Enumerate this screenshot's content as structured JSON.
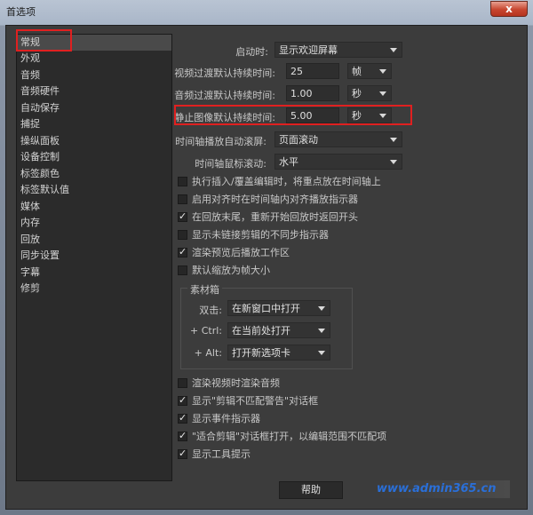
{
  "window": {
    "title": "首选项",
    "close_label": "x"
  },
  "sidebar": {
    "items": [
      {
        "label": "常规",
        "selected": true
      },
      {
        "label": "外观"
      },
      {
        "label": "音频"
      },
      {
        "label": "音频硬件"
      },
      {
        "label": "自动保存"
      },
      {
        "label": "捕捉"
      },
      {
        "label": "操纵面板"
      },
      {
        "label": "设备控制"
      },
      {
        "label": "标签颜色"
      },
      {
        "label": "标签默认值"
      },
      {
        "label": "媒体"
      },
      {
        "label": "内存"
      },
      {
        "label": "回放"
      },
      {
        "label": "同步设置"
      },
      {
        "label": "字幕"
      },
      {
        "label": "修剪"
      }
    ]
  },
  "general": {
    "startup_label": "启动时:",
    "startup_value": "显示欢迎屏幕",
    "video_transition_label": "视频过渡默认持续时间:",
    "video_transition_value": "25",
    "video_transition_unit": "帧",
    "audio_transition_label": "音频过渡默认持续时间:",
    "audio_transition_value": "1.00",
    "audio_transition_unit": "秒",
    "still_image_label": "静止图像默认持续时间:",
    "still_image_value": "5.00",
    "still_image_unit": "秒",
    "timeline_scroll_label": "时间轴播放自动滚屏:",
    "timeline_scroll_value": "页面滚动",
    "mouse_scroll_label": "时间轴鼠标滚动:",
    "mouse_scroll_value": "水平"
  },
  "checkboxes": [
    {
      "label": "执行插入/覆盖编辑时，将重点放在时间轴上",
      "checked": false
    },
    {
      "label": "启用对齐时在时间轴内对齐播放指示器",
      "checked": false
    },
    {
      "label": "在回放末尾，重新开始回放时返回开头",
      "checked": true
    },
    {
      "label": "显示未链接剪辑的不同步指示器",
      "checked": false
    },
    {
      "label": "渲染预览后播放工作区",
      "checked": true
    },
    {
      "label": "默认缩放为帧大小",
      "checked": false
    }
  ],
  "bin": {
    "title": "素材箱",
    "double_click_label": "双击:",
    "double_click_value": "在新窗口中打开",
    "ctrl_label": "+ Ctrl:",
    "ctrl_value": "在当前处打开",
    "alt_label": "+ Alt:",
    "alt_value": "打开新选项卡"
  },
  "checkboxes2": [
    {
      "label": "渲染视频时渲染音频",
      "checked": false
    },
    {
      "label": "显示\"剪辑不匹配警告\"对话框",
      "checked": true
    },
    {
      "label": "显示事件指示器",
      "checked": true
    },
    {
      "label": "\"适合剪辑\"对话框打开，以编辑范围不匹配项",
      "checked": true
    },
    {
      "label": "显示工具提示",
      "checked": true
    }
  ],
  "footer": {
    "help_label": "帮助",
    "watermark": "www.admin365.cn"
  },
  "colors": {
    "highlight": "#e02020",
    "watermark": "#2a6fd8"
  }
}
